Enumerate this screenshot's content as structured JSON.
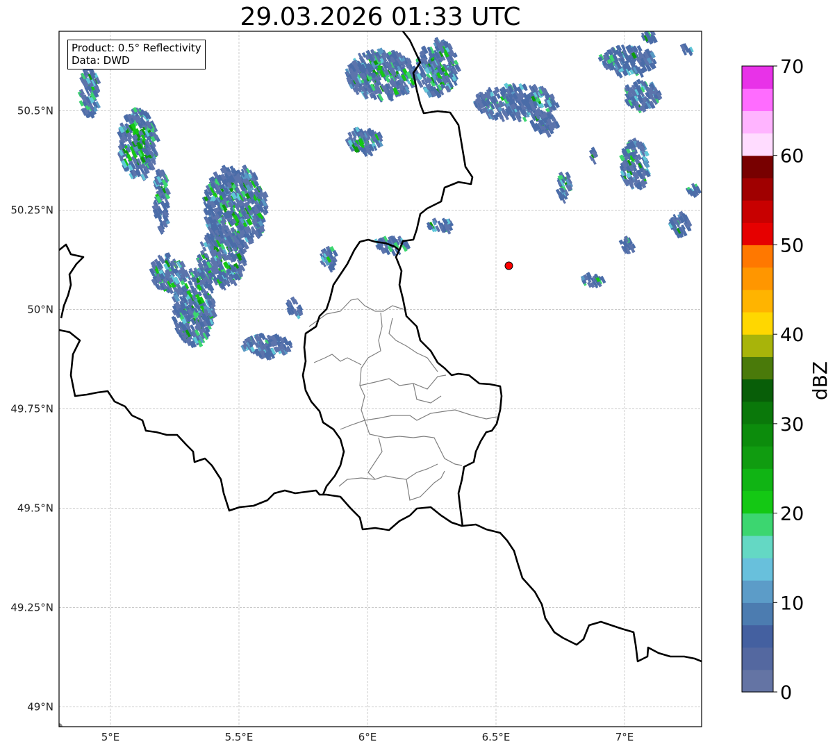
{
  "title": "29.03.2026 01:33 UTC",
  "info": {
    "product": "Product: 0.5° Reflectivity",
    "source": "Data: DWD"
  },
  "map": {
    "lon_range": [
      4.8,
      7.3
    ],
    "lat_range": [
      48.95,
      50.7
    ],
    "lon_ticks": [
      {
        "value": 5.0,
        "label": "5°E"
      },
      {
        "value": 5.5,
        "label": "5.5°E"
      },
      {
        "value": 6.0,
        "label": "6°E"
      },
      {
        "value": 6.5,
        "label": "6.5°E"
      },
      {
        "value": 7.0,
        "label": "7°E"
      }
    ],
    "lat_ticks": [
      {
        "value": 50.5,
        "label": "50.5°N"
      },
      {
        "value": 50.25,
        "label": "50.25°N"
      },
      {
        "value": 50.0,
        "label": "50°N"
      },
      {
        "value": 49.75,
        "label": "49.75°N"
      },
      {
        "value": 49.5,
        "label": "49.5°N"
      },
      {
        "value": 49.25,
        "label": "49.25°N"
      },
      {
        "value": 49.0,
        "label": "49°N"
      }
    ],
    "gridlines": true,
    "radar_site": {
      "lon": 6.55,
      "lat": 50.11,
      "color": "#ff0000"
    },
    "border_color": "#000000",
    "district_color": "#808080"
  },
  "colorbar": {
    "label": "dBZ",
    "min": 0,
    "max": 70,
    "tick_labels": [
      "0",
      "10",
      "20",
      "30",
      "40",
      "50",
      "60",
      "70"
    ],
    "colors": [
      "#6474a4",
      "#5468a0",
      "#4460a0",
      "#4c7cb0",
      "#5c9cc8",
      "#68c0dc",
      "#64d8c4",
      "#3cd670",
      "#14c814",
      "#10b414",
      "#109c10",
      "#0c8c0c",
      "#0a780a",
      "#085e08",
      "#4a7a0a",
      "#a8b40a",
      "#ffd700",
      "#ffb400",
      "#ff9600",
      "#ff7800",
      "#e60000",
      "#c80000",
      "#a00000",
      "#780000",
      "#ffdcff",
      "#ffb4ff",
      "#ff6cff",
      "#e832e8"
    ]
  },
  "echo_colors": [
    "#5c74ac",
    "#4a6ca8",
    "#5898c4",
    "#60c8d8",
    "#3cd670",
    "#14c814",
    "#0c9c0c"
  ]
}
